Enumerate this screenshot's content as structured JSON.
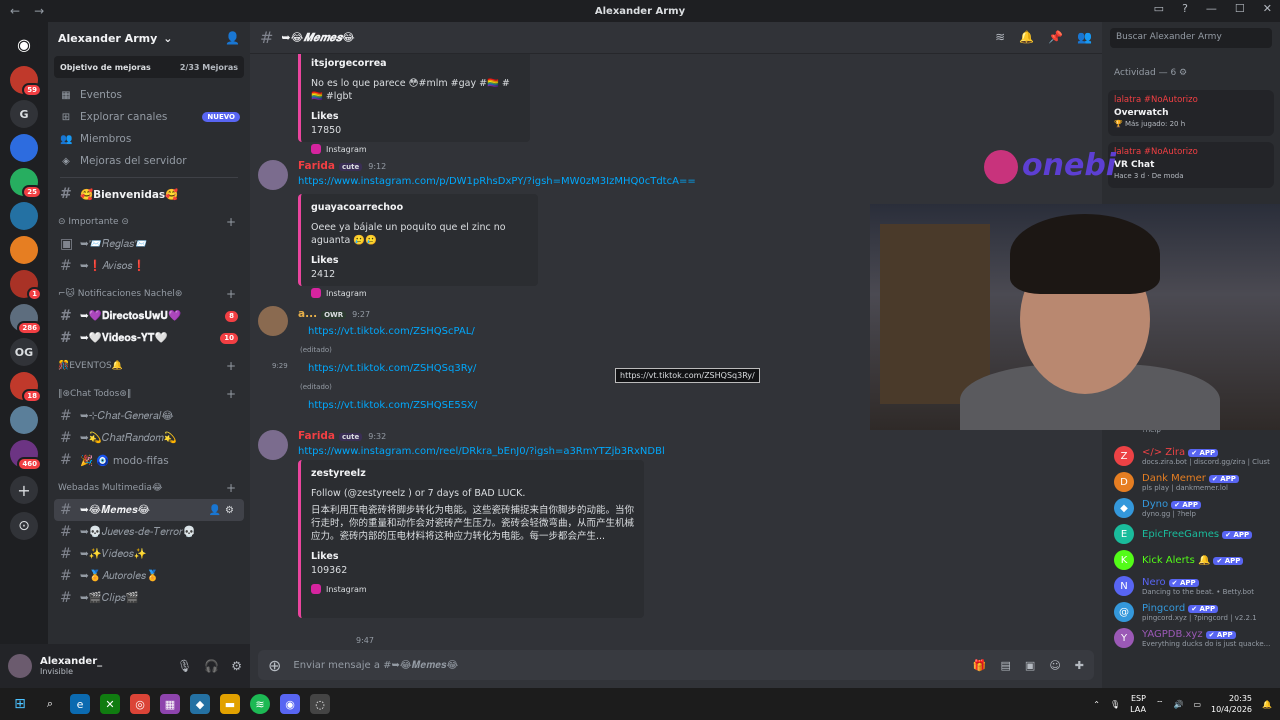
{
  "titlebar": {
    "title": "Alexander Army",
    "back": "←",
    "fwd": "→"
  },
  "guilds": {
    "items": [
      {
        "label": "",
        "badge": "59",
        "color": "#c0392b"
      },
      {
        "label": "G",
        "badge": "",
        "color": "#313338"
      },
      {
        "label": "",
        "badge": "",
        "color": "#2d6cdf"
      },
      {
        "label": "",
        "badge": "25",
        "color": "#27ae60"
      },
      {
        "label": "",
        "badge": "",
        "color": "#2471a3"
      },
      {
        "label": "",
        "badge": "",
        "color": "#e67e22"
      },
      {
        "label": "",
        "badge": "1",
        "color": "#a93226"
      },
      {
        "label": "",
        "badge": "286",
        "color": "#5d6d7e"
      },
      {
        "label": "OG",
        "badge": "",
        "color": "#313338"
      },
      {
        "label": "",
        "badge": "18",
        "color": "#c0392b"
      },
      {
        "label": "",
        "badge": "",
        "color": "#5b7f9a"
      },
      {
        "label": "",
        "badge": "460",
        "color": "#6c3483"
      }
    ],
    "add_label": "+",
    "explore_label": "⊙"
  },
  "server": {
    "name": "Alexander Army",
    "goal_label": "Objetivo de mejoras",
    "goal_progress": "2/33 Mejoras",
    "nav": [
      {
        "icon": "▦",
        "label": "Eventos"
      },
      {
        "icon": "⊞",
        "label": "Explorar canales",
        "badge": "NUEVO"
      },
      {
        "icon": "👥",
        "label": "Miembros"
      },
      {
        "icon": "◈",
        "label": "Mejoras del servidor"
      }
    ]
  },
  "channels": {
    "bienvenidas": "🥰Bienvenidas🥰",
    "cat_importante": "⊝ Importante ⊝",
    "reglas": "➥📨𝑅𝑒𝑔𝑙𝑎𝑠📨",
    "avisos": "➥❗𝐴𝑣𝑖𝑠𝑜𝑠❗",
    "cat_notificaciones": "⌐🐱 Notificaciones Nachel⊛",
    "directos": "➥💜𝐃𝐢𝐫𝐞𝐜𝐭𝐨𝐬𝐔𝐰𝐔💜",
    "directos_count": "8",
    "videos_yt": "➥🤍𝐕𝐢𝐝𝐞𝐨𝐬-𝐘𝐓🤍",
    "videos_yt_count": "10",
    "cat_eventos": "🎊EVENTOS🔔",
    "cat_chat": "‖⊛Chat Todos⊛‖",
    "chat_general": "➥⊹𝐶ℎ𝑎𝑡-𝐺𝑒𝑛𝑒𝑟𝑎𝑙😂",
    "chat_random": "➥💫𝐶ℎ𝑎𝑡𝑅𝑎𝑛𝑑𝑜𝑚💫",
    "modo_fifas": "🎉 🧿 modo-fifas",
    "cat_webadas": "Webadas Multimedia😂",
    "memes": "➥😂𝑴𝒆𝒎𝒆𝒔😂",
    "jueves": "➥💀𝐽𝑢𝑒𝑣𝑒𝑠-𝑑𝑒-𝑇𝑒𝑟𝑟𝑜𝑟💀",
    "videos": "➥✨𝑉𝑖𝑑𝑒𝑜𝑠✨",
    "autoroles": "➥🏅𝐴𝑢𝑡𝑜𝑟𝑜𝑙𝑒𝑠🏅",
    "clips": "➥🎬𝐶𝑙𝑖𝑝𝑠🎬"
  },
  "user": {
    "name": "Alexander_",
    "status": "Invisible"
  },
  "header": {
    "channel": "➥😂𝑴𝒆𝒎𝒆𝒔😂"
  },
  "messages": {
    "m0_embed_author": "itsjorgecorrea",
    "m0_embed_text": "No es lo que parece 😳#mlm #gay #🏳️‍🌈 #🏳️‍🌈 #lgbt",
    "m0_likes_label": "Likes",
    "m0_likes": "17850",
    "m0_footer": "Instagram",
    "m1_author": "Farida",
    "m1_tag": "cute",
    "m1_time": "9:12",
    "m1_link": "https://www.instagram.com/p/DW1pRhsDxPY/?igsh=MW0zM3IzMHQ0cTdtcA==",
    "m1_embed_author": "guayacoarrechoo",
    "m1_embed_text": "Oeee ya bájale un poquito que el zinc no aguanta 🥲🥲",
    "m1_likes_label": "Likes",
    "m1_likes": "2412",
    "m1_footer": "Instagram",
    "m2_author": "a...",
    "m2_tag": "OWR",
    "m2_time": "9:27",
    "m2_link1": "https://vt.tiktok.com/ZSHQScPAL/",
    "m2_edited1": "(editado)",
    "m2_time2": "9:29",
    "m2_link2": "https://vt.tiktok.com/ZSHQSq3Ry/",
    "m2_edited2": "(editado)",
    "m2_link3": "https://vt.tiktok.com/ZSHQSE5SX/",
    "tooltip": "https://vt.tiktok.com/ZSHQSq3Ry/",
    "m3_author": "Farida",
    "m3_tag": "cute",
    "m3_time": "9:32",
    "m3_link": "https://www.instagram.com/reel/DRkra_bEnJ0/?igsh=a3RmYTZjb3RxNDBl",
    "m3_embed_author": "zestyreelz",
    "m3_embed_text1": "Follow (@zestyreelz ) or 7 days of BAD LUCK.",
    "m3_embed_text2": "日本利用压电瓷砖将脚步转化为电能。这些瓷砖捕捉来自你脚步的动能。当你行走时，你的重量和动作会对瓷砖产生压力。瓷砖会轻微弯曲，从而产生机械应力。瓷砖内部的压电材料将这种应力转化为电能。每一步都会产生...",
    "m3_likes_label": "Likes",
    "m3_likes": "109362",
    "m3_footer": "Instagram",
    "m4_time": "9:47"
  },
  "composer": {
    "placeholder": "Enviar mensaje a #➥😂𝑴𝒆𝒎𝒆𝒔😂"
  },
  "members": {
    "search_placeholder": "Buscar Alexander Army",
    "activity_header": "Actividad — 6 ⚙",
    "activities": [
      {
        "name": "lalatra #NoAutorizo",
        "game": "Overwatch",
        "detail": "🏆 Más jugado: 20 h"
      },
      {
        "name": "lalatra #NoAutorizo",
        "game": "VR Chat",
        "detail": "Hace 3 d · De moda"
      }
    ],
    "list": [
      {
        "name": "</> Zira",
        "status": "docs.zira.bot | discord.gg/zira | Clust",
        "color": "#ed4245",
        "avatar": "Z"
      },
      {
        "name": "Dank Memer",
        "status": "pls play | dankmemer.lol",
        "color": "#e67e22",
        "avatar": "D"
      },
      {
        "name": "Dyno",
        "status": "dyno.gg | ?help",
        "color": "#3498db",
        "avatar": "◆"
      },
      {
        "name": "EpicFreeGames",
        "status": "",
        "color": "#1abc9c",
        "avatar": "E"
      },
      {
        "name": "Kick Alerts 🔔",
        "status": "",
        "color": "#53fc18",
        "avatar": "K"
      },
      {
        "name": "Nero",
        "status": "Dancing to the beat. • Betty.bot",
        "color": "#5865f2",
        "avatar": "N"
      },
      {
        "name": "Pingcord",
        "status": "pingcord.xyz | ?pingcord | v2.2.1",
        "color": "#3498db",
        "avatar": "@"
      },
      {
        "name": "YAGPDB.xyz",
        "status": "Everything ducks do is just quacke...",
        "color": "#9b59b6",
        "avatar": "Y"
      }
    ],
    "app_label": "✔ APP",
    "help_partial": "?help"
  },
  "overlay": {
    "logo_text": "onebi"
  },
  "taskbar": {
    "lang1": "ESP",
    "lang2": "LAA",
    "time": "20:35",
    "date": "10/4/2026"
  }
}
